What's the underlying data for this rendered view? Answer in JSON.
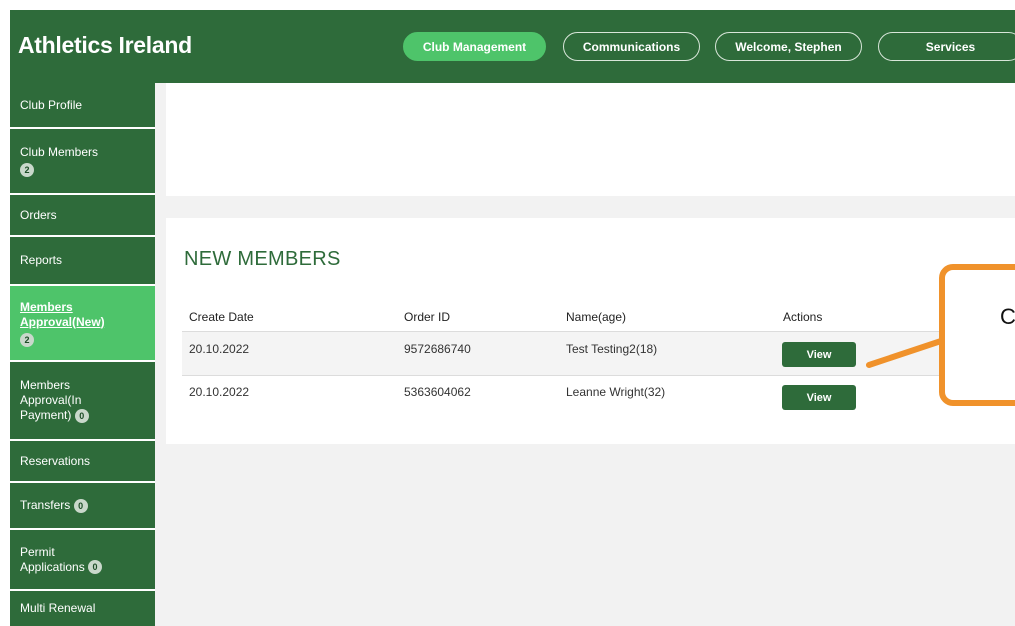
{
  "header": {
    "brand": "Athletics Ireland",
    "nav": [
      {
        "label": "Club Management",
        "active": true
      },
      {
        "label": "Communications",
        "active": false
      },
      {
        "label": "Welcome, Stephen",
        "active": false
      },
      {
        "label": "Services",
        "active": false
      }
    ]
  },
  "sidebar": {
    "items": [
      {
        "label": "Club Profile"
      },
      {
        "label": "Club Members",
        "badge": "2"
      },
      {
        "label": "Orders"
      },
      {
        "label": "Reports"
      },
      {
        "label_line1": "Members",
        "label_line2": "Approval(New)",
        "badge": "2",
        "active": true
      },
      {
        "label_line1": "Members",
        "label_line2": "Approval(In",
        "label_line3": "Payment)",
        "badge": "0"
      },
      {
        "label": "Reservations"
      },
      {
        "label": "Transfers",
        "badge": "0"
      },
      {
        "label_line1": "Permit",
        "label_line2": "Applications",
        "badge": "0"
      },
      {
        "label": "Multi Renewal"
      }
    ]
  },
  "new_members": {
    "title": "NEW MEMBERS",
    "columns": [
      "Create Date",
      "Order ID",
      "Name(age)",
      "Actions"
    ],
    "rows": [
      {
        "create_date": "20.10.2022",
        "order_id": "9572686740",
        "name_age": "Test Testing2(18)",
        "action": "View"
      },
      {
        "create_date": "20.10.2022",
        "order_id": "5363604062",
        "name_age": "Leanne Wright(32)",
        "action": "View"
      }
    ]
  },
  "callout": {
    "text": "C",
    "color": "#f0922b"
  },
  "colors": {
    "brand_green": "#2e6b3a",
    "active_green": "#4ec46a"
  }
}
